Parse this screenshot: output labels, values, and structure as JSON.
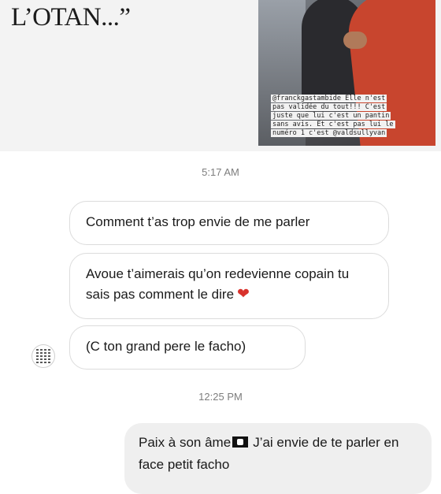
{
  "header": {
    "quote_text": "L’OTAN...”"
  },
  "story": {
    "caption_lines": [
      "@franckgastambide Elle n'est",
      "pas validée du tout!!! C'est",
      "juste que lui c'est un pantin",
      "sans avis. Et c'est pas lui le",
      "numéro 1 c'est @valdsullyvan"
    ]
  },
  "messages": {
    "timestamp_1": "5:17 AM",
    "incoming": [
      "Comment t’as trop envie de me parler",
      "Avoue t’aimerais qu’on redevienne copain tu sais pas comment le dire",
      "(C ton grand pere le facho)"
    ],
    "timestamp_2": "12:25 PM",
    "outgoing_part1": "Paix à son âme",
    "outgoing_part2": "J’ai envie de te parler en face petit facho"
  },
  "icons": {
    "heart": "heart-icon",
    "flag": "pirate-flag-icon",
    "avatar": "qr-avatar"
  },
  "colors": {
    "heart": "#d8322c",
    "bubble_border": "#dcdcdc",
    "outgoing_bg": "#efefef"
  }
}
